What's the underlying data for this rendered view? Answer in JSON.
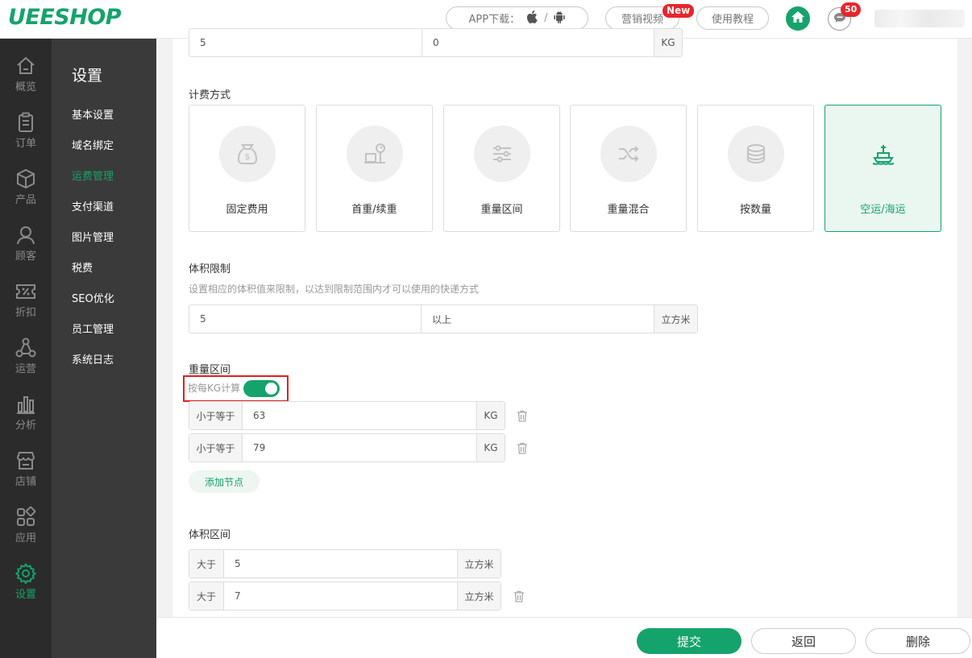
{
  "header": {
    "logo": "UEESHOP",
    "app_download": "APP下载：",
    "app_sep": "/",
    "marketing_video": "营销视频",
    "new_badge": "New",
    "tutorial": "使用教程",
    "message_count": "50"
  },
  "iconbar": [
    {
      "label": "概览",
      "icon": "home-outline-icon",
      "active": false
    },
    {
      "label": "订单",
      "icon": "clipboard-icon",
      "active": false
    },
    {
      "label": "产品",
      "icon": "cube-icon",
      "active": false
    },
    {
      "label": "顾客",
      "icon": "user-icon",
      "active": false
    },
    {
      "label": "折扣",
      "icon": "percent-ticket-icon",
      "active": false
    },
    {
      "label": "运营",
      "icon": "network-icon",
      "active": false
    },
    {
      "label": "分析",
      "icon": "bar-chart-icon",
      "active": false
    },
    {
      "label": "店铺",
      "icon": "store-icon",
      "active": false
    },
    {
      "label": "应用",
      "icon": "apps-icon",
      "active": false
    },
    {
      "label": "设置",
      "icon": "gear-icon",
      "active": true
    }
  ],
  "subnav": {
    "title": "设置",
    "items": [
      "基本设置",
      "域名绑定",
      "运费管理",
      "支付渠道",
      "图片管理",
      "税费",
      "SEO优化",
      "员工管理",
      "系统日志"
    ],
    "active": "运费管理"
  },
  "top_row": {
    "value1": "5",
    "value2": "0",
    "unit": "KG"
  },
  "billing": {
    "title": "计费方式",
    "options": [
      {
        "label": "固定费用",
        "icon": "money-bag-icon"
      },
      {
        "label": "首重/续重",
        "icon": "scale-icon"
      },
      {
        "label": "重量区间",
        "icon": "sliders-icon"
      },
      {
        "label": "重量混合",
        "icon": "shuffle-icon"
      },
      {
        "label": "按数量",
        "icon": "stack-icon"
      },
      {
        "label": "空运/海运",
        "icon": "ship-icon"
      }
    ],
    "selected": "空运/海运"
  },
  "volume_limit": {
    "title": "体积限制",
    "hint": "设置相应的体积值来限制，以达到限制范围内才可以使用的快递方式",
    "value": "5",
    "placeholder": "以上",
    "unit": "立方米"
  },
  "weight_range": {
    "title": "重量区间",
    "toggle_label": "按每KG计算",
    "toggle_on": true,
    "rows": [
      {
        "prefix": "小于等于",
        "value": "63",
        "unit": "KG"
      },
      {
        "prefix": "小于等于",
        "value": "79",
        "unit": "KG"
      }
    ],
    "add_label": "添加节点"
  },
  "volume_range": {
    "title": "体积区间",
    "rows": [
      {
        "prefix": "大于",
        "value": "5",
        "unit": "立方米"
      },
      {
        "prefix": "大于",
        "value": "7",
        "unit": "立方米"
      }
    ]
  },
  "footer": {
    "submit": "提交",
    "back": "返回",
    "delete": "删除"
  },
  "colors": {
    "brand": "#15a36c",
    "badge": "#e8262a",
    "highlight_box": "#e02020"
  }
}
